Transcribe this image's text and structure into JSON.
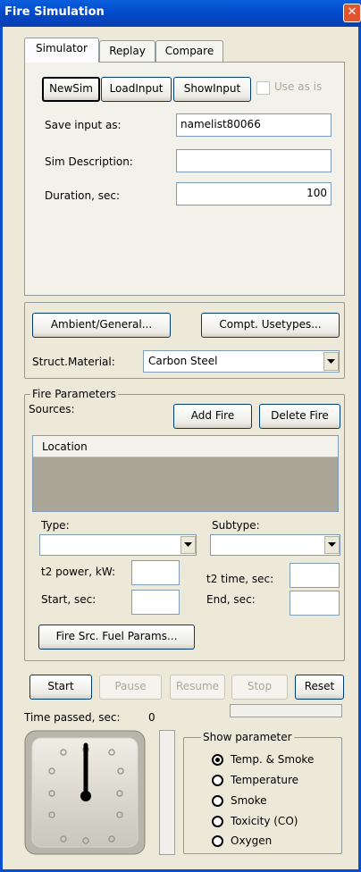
{
  "window": {
    "title": "Fire Simulation",
    "close_glyph": "✕"
  },
  "tabs": [
    "Simulator",
    "Replay",
    "Compare"
  ],
  "sim_buttons": {
    "new": "NewSim",
    "load": "LoadInput",
    "show": "ShowInput",
    "use_as_is": "Use as is"
  },
  "fields": {
    "save_input_label": "Save input as:",
    "save_input_value": "namelist80066",
    "description_label": "Sim Description:",
    "description_value": "",
    "duration_label": "Duration, sec:",
    "duration_value": "100"
  },
  "general": {
    "ambient_button": "Ambient/General...",
    "compt_button": "Compt. Usetypes...",
    "material_label": "Struct.Material:",
    "material_value": "Carbon Steel"
  },
  "fire": {
    "group_title": "Fire Parameters",
    "sources_label": "Sources:",
    "add_button": "Add Fire",
    "delete_button": "Delete Fire",
    "list_header": "Location",
    "type_label": "Type:",
    "subtype_label": "Subtype:",
    "t2_power_label": "t2 power, kW:",
    "t2_time_label": "t2 time, sec:",
    "start_label": "Start, sec:",
    "end_label": "End, sec:",
    "fuel_button": "Fire Src. Fuel Params..."
  },
  "controls": {
    "start": "Start",
    "pause": "Pause",
    "resume": "Resume",
    "stop": "Stop",
    "reset": "Reset"
  },
  "time": {
    "label": "Time passed, sec:",
    "value": "0"
  },
  "show_parameter": {
    "title": "Show parameter",
    "options": [
      "Temp. & Smoke",
      "Temperature",
      "Smoke",
      "Toxicity (CO)",
      "Oxygen"
    ],
    "selected": "Temp. & Smoke"
  }
}
